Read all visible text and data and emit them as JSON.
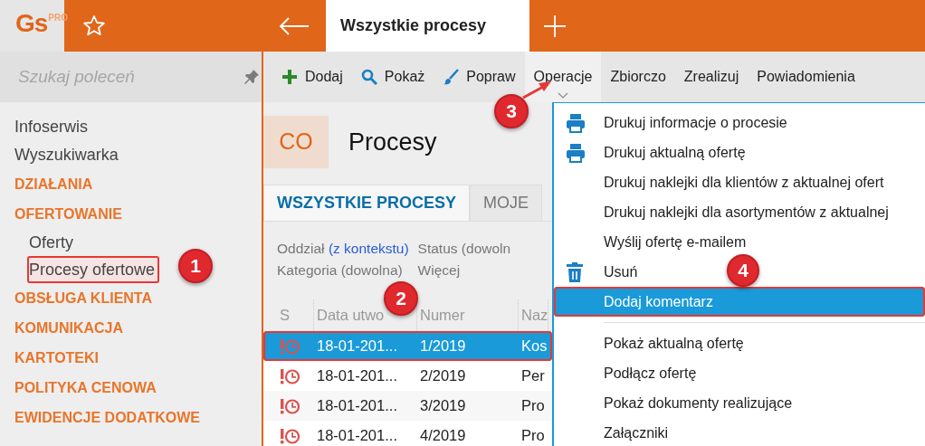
{
  "app": {
    "logo": "Gs",
    "logo_badge": "PRO"
  },
  "topbar": {
    "tabs": [
      {
        "label": "Wszystkie procesy",
        "selected": true
      }
    ]
  },
  "sidebar": {
    "search": {
      "placeholder": "Szukaj poleceń"
    },
    "items": [
      {
        "label": "Infoserwis",
        "kind": "link"
      },
      {
        "label": "Wyszukiwarka",
        "kind": "link"
      },
      {
        "label": "DZIAŁANIA",
        "kind": "section"
      },
      {
        "label": "OFERTOWANIE",
        "kind": "section",
        "children": [
          {
            "label": "Oferty",
            "highlighted": false
          },
          {
            "label": "Procesy ofertowe",
            "highlighted": true
          }
        ]
      },
      {
        "label": "OBSŁUGA KLIENTA",
        "kind": "section"
      },
      {
        "label": "KOMUNIKACJA",
        "kind": "section"
      },
      {
        "label": "KARTOTEKI",
        "kind": "section"
      },
      {
        "label": "POLITYKA CENOWA",
        "kind": "section"
      },
      {
        "label": "EWIDENCJE DODATKOWE",
        "kind": "section"
      }
    ]
  },
  "toolbar": [
    {
      "label": "Dodaj",
      "kind": "add",
      "active": false
    },
    {
      "label": "Pokaż",
      "kind": "search",
      "active": false
    },
    {
      "label": "Popraw",
      "kind": "edit",
      "active": false
    },
    {
      "label": "Operacje",
      "kind": "plain",
      "active": true
    },
    {
      "label": "Zbiorczo",
      "kind": "plain",
      "active": false
    },
    {
      "label": "Zrealizuj",
      "kind": "plain",
      "active": false
    },
    {
      "label": "Powiadomienia",
      "kind": "plain",
      "active": false
    }
  ],
  "page": {
    "badge": "CO",
    "title": "Procesy",
    "tabs": [
      {
        "label": "WSZYSTKIE PROCESY",
        "selected": true
      },
      {
        "label": "MOJE",
        "selected": false
      }
    ],
    "filters": [
      {
        "label": "Oddział",
        "value": "(z kontekstu)"
      },
      {
        "label": "Status (dowoln"
      },
      {
        "label": "Kategoria (dowolna)"
      },
      {
        "label": "Więcej"
      }
    ],
    "table": {
      "columns": [
        "S",
        "Data utwo",
        "Numer",
        "Naz"
      ],
      "rows": [
        {
          "date": "18-01-201...",
          "number": "1/2019",
          "name": "Kos",
          "selected": true,
          "highlighted": true
        },
        {
          "date": "18-01-201...",
          "number": "2/2019",
          "name": "Per",
          "selected": false,
          "highlighted": false
        },
        {
          "date": "18-01-201...",
          "number": "3/2019",
          "name": "Pro",
          "selected": false,
          "highlighted": false
        },
        {
          "date": "18-01-201...",
          "number": "4/2019",
          "name": "Pro",
          "selected": false,
          "highlighted": false
        }
      ]
    }
  },
  "menu": {
    "items": [
      {
        "label": "Drukuj informacje o procesie",
        "kind": "print",
        "selected": false,
        "highlighted": false
      },
      {
        "label": "Drukuj aktualną ofertę",
        "kind": "print",
        "selected": false,
        "highlighted": false
      },
      {
        "label": "Drukuj naklejki dla klientów z aktualnej ofert",
        "kind": "plain",
        "selected": false,
        "highlighted": false
      },
      {
        "label": "Drukuj naklejki dla asortymentów z aktualnej",
        "kind": "plain",
        "selected": false,
        "highlighted": false
      },
      {
        "label": "Wyślij ofertę e-mailem",
        "kind": "plain",
        "selected": false,
        "highlighted": false
      },
      {
        "label": "Usuń",
        "kind": "delete",
        "selected": false,
        "highlighted": false
      },
      {
        "label": "Dodaj komentarz",
        "kind": "plain",
        "selected": true,
        "highlighted": true
      },
      {
        "kind": "separator"
      },
      {
        "label": "Pokaż aktualną ofertę",
        "kind": "plain",
        "selected": false,
        "highlighted": false
      },
      {
        "label": "Podłącz ofertę",
        "kind": "plain",
        "selected": false,
        "highlighted": false
      },
      {
        "label": "Pokaż dokumenty realizujące",
        "kind": "plain",
        "selected": false,
        "highlighted": false
      },
      {
        "label": "Załączniki",
        "kind": "plain",
        "selected": false,
        "highlighted": false
      }
    ]
  },
  "annotations": [
    {
      "label": "1",
      "arrow": false
    },
    {
      "label": "2",
      "arrow": false
    },
    {
      "label": "3",
      "arrow": true
    },
    {
      "label": "4",
      "arrow": false
    }
  ]
}
